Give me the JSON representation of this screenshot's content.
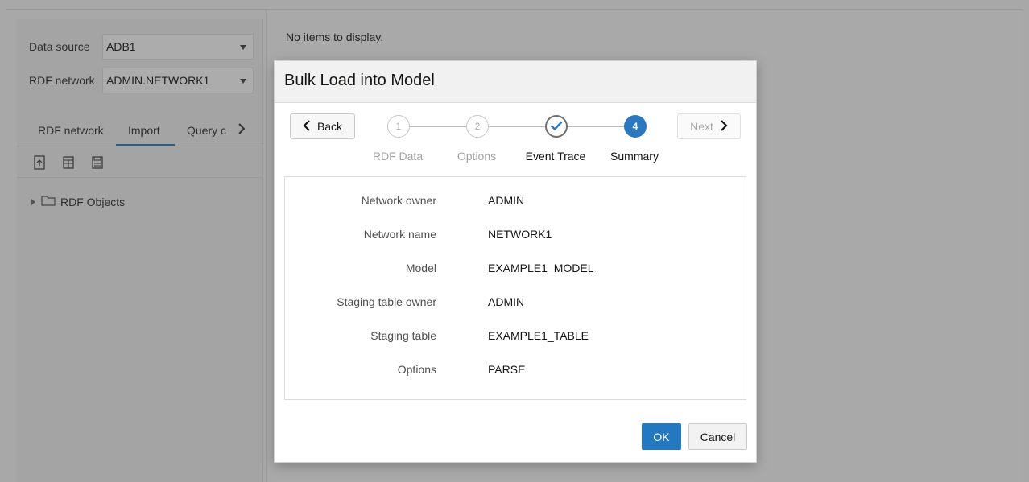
{
  "sidebar": {
    "data_source_label": "Data source",
    "data_source_value": "ADB1",
    "rdf_network_label": "RDF network",
    "rdf_network_value": "ADMIN.NETWORK1",
    "tabs": [
      {
        "label": "RDF network",
        "active": false
      },
      {
        "label": "Import",
        "active": true
      },
      {
        "label": "Query c",
        "active": false
      }
    ],
    "toolbar_icons": [
      "upload-file-icon",
      "table-import-icon",
      "save-icon"
    ],
    "tree": {
      "label": "RDF Objects",
      "icon": "folder-icon"
    }
  },
  "main": {
    "empty_message": "No items to display."
  },
  "dialog": {
    "title": "Bulk Load into Model",
    "back_label": "Back",
    "next_label": "Next",
    "steps": [
      {
        "number": "1",
        "label": "RDF Data",
        "state": "todo"
      },
      {
        "number": "2",
        "label": "Options",
        "state": "todo"
      },
      {
        "number": "",
        "label": "Event Trace",
        "state": "done"
      },
      {
        "number": "4",
        "label": "Summary",
        "state": "current"
      }
    ],
    "summary": [
      {
        "label": "Network owner",
        "value": "ADMIN"
      },
      {
        "label": "Network name",
        "value": "NETWORK1"
      },
      {
        "label": "Model",
        "value": "EXAMPLE1_MODEL"
      },
      {
        "label": "Staging table owner",
        "value": "ADMIN"
      },
      {
        "label": "Staging table",
        "value": "EXAMPLE1_TABLE"
      },
      {
        "label": "Options",
        "value": "PARSE"
      }
    ],
    "ok_label": "OK",
    "cancel_label": "Cancel"
  },
  "colors": {
    "primary": "#2279c2",
    "step_current": "#2b78c0",
    "overlay": "#a9a9a9"
  }
}
